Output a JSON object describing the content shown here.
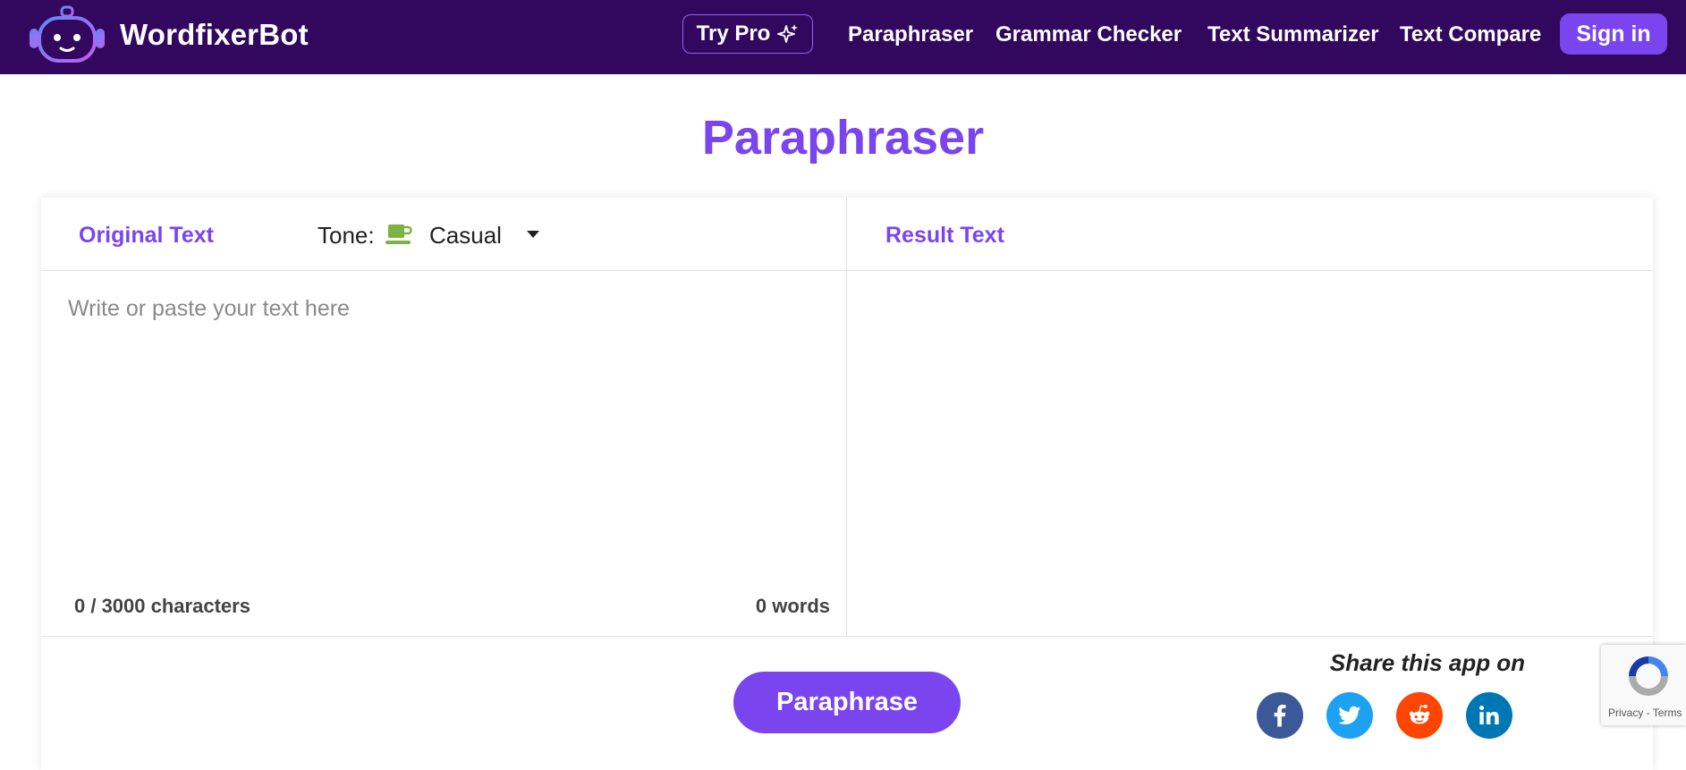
{
  "app": {
    "brand": "WordfixerBot"
  },
  "nav": {
    "try_pro": "Try Pro",
    "links": [
      "Paraphraser",
      "Grammar Checker",
      "Text Summarizer",
      "Text Compare"
    ],
    "sign_in": "Sign in"
  },
  "page": {
    "title": "Paraphraser"
  },
  "editor": {
    "original_title": "Original Text",
    "tone_label": "Tone:",
    "tone_value": "Casual",
    "tone_icon": "coffee-cup-icon",
    "input_placeholder": "Write or paste your text here",
    "input_value": "",
    "char_count": "0 / 3000 characters",
    "word_count": "0 words",
    "result_title": "Result Text"
  },
  "actions": {
    "paraphrase": "Paraphrase"
  },
  "share": {
    "title": "Share this app on",
    "networks": [
      "facebook",
      "twitter",
      "reddit",
      "linkedin"
    ]
  },
  "recaptcha": {
    "privacy": "Privacy",
    "separator": " - ",
    "terms": "Terms"
  },
  "colors": {
    "nav_bg": "#32085f",
    "accent": "#7a45ee",
    "facebook": "#3b5998",
    "twitter": "#1da1f2",
    "reddit": "#ff4500",
    "linkedin": "#0077b5",
    "tone_icon": "#7cb342"
  }
}
